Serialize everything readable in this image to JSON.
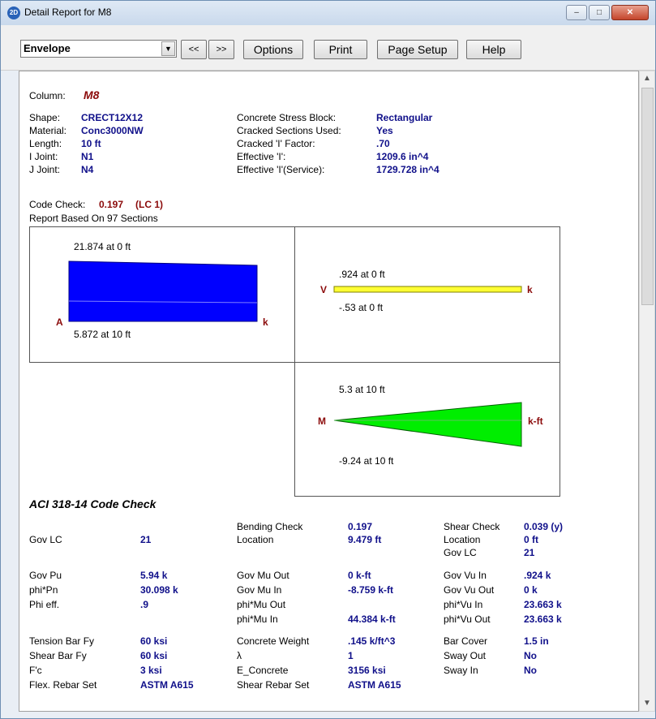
{
  "window": {
    "title": "Detail Report for M8",
    "icon_label": "2D",
    "min_glyph": "–",
    "max_glyph": "□",
    "close_glyph": "✕"
  },
  "toolbar": {
    "select_value": "Envelope",
    "select_arrow": "▼",
    "prev_label": "<<",
    "next_label": ">>",
    "options_label": "Options",
    "print_label": "Print",
    "page_setup_label": "Page Setup",
    "help_label": "Help"
  },
  "scroll": {
    "up": "▲",
    "down": "▼"
  },
  "header": {
    "column_label": "Column:",
    "column_value": "M8",
    "left": [
      {
        "label": "Shape:",
        "value": "CRECT12X12"
      },
      {
        "label": "Material:",
        "value": "Conc3000NW"
      },
      {
        "label": "Length:",
        "value": "10 ft"
      },
      {
        "label": "I Joint:",
        "value": "N1"
      },
      {
        "label": "J Joint:",
        "value": "N4"
      }
    ],
    "right": [
      {
        "label": "Concrete Stress Block:",
        "value": "Rectangular"
      },
      {
        "label": "Cracked Sections Used:",
        "value": "Yes"
      },
      {
        "label": "Cracked 'I' Factor:",
        "value": ".70"
      },
      {
        "label": "Effective 'I':",
        "value": "1209.6 in^4"
      },
      {
        "label": "Effective 'I'(Service):",
        "value": "1729.728 in^4"
      }
    ],
    "code_check_label": "Code Check:",
    "code_check_value": "0.197",
    "code_check_lc": "(LC 1)",
    "sections_note": "Report Based On 97 Sections"
  },
  "diagrams": {
    "axial": {
      "max_text": "21.874 at 0 ft",
      "min_text": "5.872 at 10 ft",
      "axis_label": "A",
      "unit": "k",
      "color": "#0000ff"
    },
    "shear": {
      "max_text": ".924 at 0 ft",
      "min_text": "-.53 at 0 ft",
      "axis_label": "V",
      "unit": "k",
      "color": "#ffff33"
    },
    "moment": {
      "max_text": "5.3 at 10 ft",
      "min_text": "-9.24 at 10 ft",
      "axis_label": "M",
      "unit": "k-ft",
      "color": "#00ee00"
    }
  },
  "code_check": {
    "title": "ACI 318-14 Code Check",
    "col1": [
      {
        "label": "Gov LC",
        "value": "21"
      },
      {
        "label": "Gov Pu",
        "value": "5.94 k"
      },
      {
        "label": "phi*Pn",
        "value": "30.098 k"
      },
      {
        "label": "Phi eff.",
        "value": ".9"
      },
      {
        "label": "Tension Bar Fy",
        "value": "60 ksi"
      },
      {
        "label": "Shear Bar Fy",
        "value": "60 ksi"
      },
      {
        "label": "F'c",
        "value": "3 ksi"
      },
      {
        "label": "Flex. Rebar Set",
        "value": "ASTM A615"
      }
    ],
    "col2": [
      {
        "label": "Bending Check",
        "value": "0.197"
      },
      {
        "label": "Location",
        "value": "9.479 ft"
      },
      {
        "label": "Gov Mu Out",
        "value": "0 k-ft"
      },
      {
        "label": "Gov Mu In",
        "value": "-8.759 k-ft"
      },
      {
        "label": "phi*Mu Out",
        "value": ""
      },
      {
        "label": "phi*Mu In",
        "value": "44.384 k-ft"
      },
      {
        "label": "Concrete Weight",
        "value": ".145 k/ft^3"
      },
      {
        "label": "λ",
        "value": "1"
      },
      {
        "label": "E_Concrete",
        "value": "3156 ksi"
      },
      {
        "label": "Shear Rebar Set",
        "value": "ASTM A615"
      }
    ],
    "col3": [
      {
        "label": "Shear Check",
        "value": "0.039 (y)"
      },
      {
        "label": "Location",
        "value": "0 ft"
      },
      {
        "label": "Gov LC",
        "value": "21"
      },
      {
        "label": "Gov Vu In",
        "value": ".924 k"
      },
      {
        "label": "Gov Vu Out",
        "value": "0 k"
      },
      {
        "label": "phi*Vu In",
        "value": "23.663 k"
      },
      {
        "label": "phi*Vu Out",
        "value": "23.663 k"
      },
      {
        "label": "Bar Cover",
        "value": "1.5 in"
      },
      {
        "label": "Sway Out",
        "value": "No"
      },
      {
        "label": "Sway In",
        "value": "No"
      }
    ]
  }
}
